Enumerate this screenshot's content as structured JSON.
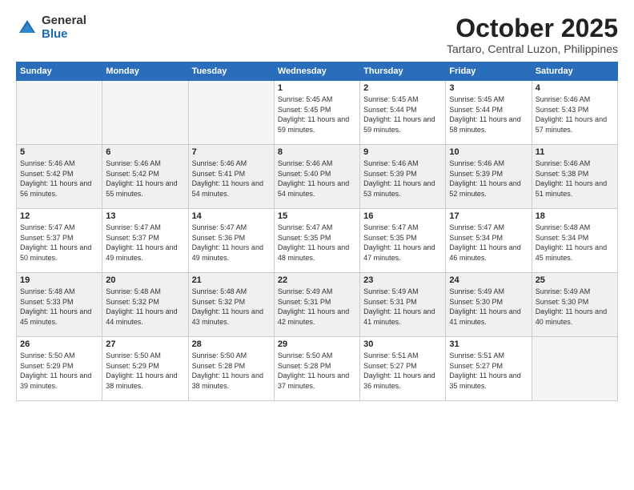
{
  "header": {
    "logo_general": "General",
    "logo_blue": "Blue",
    "month": "October 2025",
    "location": "Tartaro, Central Luzon, Philippines"
  },
  "weekdays": [
    "Sunday",
    "Monday",
    "Tuesday",
    "Wednesday",
    "Thursday",
    "Friday",
    "Saturday"
  ],
  "weeks": [
    [
      {
        "day": "",
        "empty": true
      },
      {
        "day": "",
        "empty": true
      },
      {
        "day": "",
        "empty": true
      },
      {
        "day": "1",
        "sunrise": "Sunrise: 5:45 AM",
        "sunset": "Sunset: 5:45 PM",
        "daylight": "Daylight: 11 hours and 59 minutes."
      },
      {
        "day": "2",
        "sunrise": "Sunrise: 5:45 AM",
        "sunset": "Sunset: 5:44 PM",
        "daylight": "Daylight: 11 hours and 59 minutes."
      },
      {
        "day": "3",
        "sunrise": "Sunrise: 5:45 AM",
        "sunset": "Sunset: 5:44 PM",
        "daylight": "Daylight: 11 hours and 58 minutes."
      },
      {
        "day": "4",
        "sunrise": "Sunrise: 5:46 AM",
        "sunset": "Sunset: 5:43 PM",
        "daylight": "Daylight: 11 hours and 57 minutes."
      }
    ],
    [
      {
        "day": "5",
        "sunrise": "Sunrise: 5:46 AM",
        "sunset": "Sunset: 5:42 PM",
        "daylight": "Daylight: 11 hours and 56 minutes."
      },
      {
        "day": "6",
        "sunrise": "Sunrise: 5:46 AM",
        "sunset": "Sunset: 5:42 PM",
        "daylight": "Daylight: 11 hours and 55 minutes."
      },
      {
        "day": "7",
        "sunrise": "Sunrise: 5:46 AM",
        "sunset": "Sunset: 5:41 PM",
        "daylight": "Daylight: 11 hours and 54 minutes."
      },
      {
        "day": "8",
        "sunrise": "Sunrise: 5:46 AM",
        "sunset": "Sunset: 5:40 PM",
        "daylight": "Daylight: 11 hours and 54 minutes."
      },
      {
        "day": "9",
        "sunrise": "Sunrise: 5:46 AM",
        "sunset": "Sunset: 5:39 PM",
        "daylight": "Daylight: 11 hours and 53 minutes."
      },
      {
        "day": "10",
        "sunrise": "Sunrise: 5:46 AM",
        "sunset": "Sunset: 5:39 PM",
        "daylight": "Daylight: 11 hours and 52 minutes."
      },
      {
        "day": "11",
        "sunrise": "Sunrise: 5:46 AM",
        "sunset": "Sunset: 5:38 PM",
        "daylight": "Daylight: 11 hours and 51 minutes."
      }
    ],
    [
      {
        "day": "12",
        "sunrise": "Sunrise: 5:47 AM",
        "sunset": "Sunset: 5:37 PM",
        "daylight": "Daylight: 11 hours and 50 minutes."
      },
      {
        "day": "13",
        "sunrise": "Sunrise: 5:47 AM",
        "sunset": "Sunset: 5:37 PM",
        "daylight": "Daylight: 11 hours and 49 minutes."
      },
      {
        "day": "14",
        "sunrise": "Sunrise: 5:47 AM",
        "sunset": "Sunset: 5:36 PM",
        "daylight": "Daylight: 11 hours and 49 minutes."
      },
      {
        "day": "15",
        "sunrise": "Sunrise: 5:47 AM",
        "sunset": "Sunset: 5:35 PM",
        "daylight": "Daylight: 11 hours and 48 minutes."
      },
      {
        "day": "16",
        "sunrise": "Sunrise: 5:47 AM",
        "sunset": "Sunset: 5:35 PM",
        "daylight": "Daylight: 11 hours and 47 minutes."
      },
      {
        "day": "17",
        "sunrise": "Sunrise: 5:47 AM",
        "sunset": "Sunset: 5:34 PM",
        "daylight": "Daylight: 11 hours and 46 minutes."
      },
      {
        "day": "18",
        "sunrise": "Sunrise: 5:48 AM",
        "sunset": "Sunset: 5:34 PM",
        "daylight": "Daylight: 11 hours and 45 minutes."
      }
    ],
    [
      {
        "day": "19",
        "sunrise": "Sunrise: 5:48 AM",
        "sunset": "Sunset: 5:33 PM",
        "daylight": "Daylight: 11 hours and 45 minutes."
      },
      {
        "day": "20",
        "sunrise": "Sunrise: 5:48 AM",
        "sunset": "Sunset: 5:32 PM",
        "daylight": "Daylight: 11 hours and 44 minutes."
      },
      {
        "day": "21",
        "sunrise": "Sunrise: 5:48 AM",
        "sunset": "Sunset: 5:32 PM",
        "daylight": "Daylight: 11 hours and 43 minutes."
      },
      {
        "day": "22",
        "sunrise": "Sunrise: 5:49 AM",
        "sunset": "Sunset: 5:31 PM",
        "daylight": "Daylight: 11 hours and 42 minutes."
      },
      {
        "day": "23",
        "sunrise": "Sunrise: 5:49 AM",
        "sunset": "Sunset: 5:31 PM",
        "daylight": "Daylight: 11 hours and 41 minutes."
      },
      {
        "day": "24",
        "sunrise": "Sunrise: 5:49 AM",
        "sunset": "Sunset: 5:30 PM",
        "daylight": "Daylight: 11 hours and 41 minutes."
      },
      {
        "day": "25",
        "sunrise": "Sunrise: 5:49 AM",
        "sunset": "Sunset: 5:30 PM",
        "daylight": "Daylight: 11 hours and 40 minutes."
      }
    ],
    [
      {
        "day": "26",
        "sunrise": "Sunrise: 5:50 AM",
        "sunset": "Sunset: 5:29 PM",
        "daylight": "Daylight: 11 hours and 39 minutes."
      },
      {
        "day": "27",
        "sunrise": "Sunrise: 5:50 AM",
        "sunset": "Sunset: 5:29 PM",
        "daylight": "Daylight: 11 hours and 38 minutes."
      },
      {
        "day": "28",
        "sunrise": "Sunrise: 5:50 AM",
        "sunset": "Sunset: 5:28 PM",
        "daylight": "Daylight: 11 hours and 38 minutes."
      },
      {
        "day": "29",
        "sunrise": "Sunrise: 5:50 AM",
        "sunset": "Sunset: 5:28 PM",
        "daylight": "Daylight: 11 hours and 37 minutes."
      },
      {
        "day": "30",
        "sunrise": "Sunrise: 5:51 AM",
        "sunset": "Sunset: 5:27 PM",
        "daylight": "Daylight: 11 hours and 36 minutes."
      },
      {
        "day": "31",
        "sunrise": "Sunrise: 5:51 AM",
        "sunset": "Sunset: 5:27 PM",
        "daylight": "Daylight: 11 hours and 35 minutes."
      },
      {
        "day": "",
        "empty": true
      }
    ]
  ]
}
